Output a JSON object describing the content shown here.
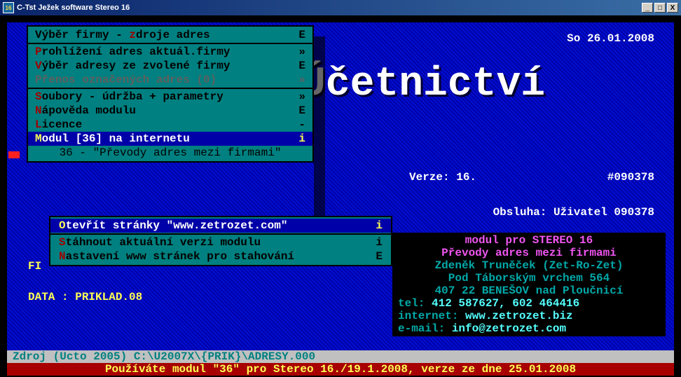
{
  "window": {
    "title": "C-Tst Ježek software Stereo 16",
    "icon_text": "16"
  },
  "date": "So 26.01.2008",
  "big_title": "Účetnictví",
  "version_label": "Verze: 16.",
  "version_id": "#090378",
  "operator_label": "Obsluha: Uživatel 090378",
  "info": {
    "l1": "modul pro STEREO 16",
    "l2": "Převody adres mezi firmami",
    "l3": "Zdeněk Truněček (Zet-Ro-Zet)",
    "l4": "Pod Táborským vrchem 564",
    "l5": "407 22 BENEŠOV nad Ploučnicí",
    "tel_label": "tel:",
    "tel_value": " 412 587627, 602 464416",
    "web_label": "internet:",
    "web_value": " www.zetrozet.biz",
    "mail_label": "e-mail: ",
    "mail_value": " info@zetrozet.com"
  },
  "menu1": {
    "items": [
      {
        "label": "Výběr firmy - ",
        "hk": "z",
        "rest": "droje adres",
        "key": "E",
        "type": "row"
      },
      {
        "type": "sep"
      },
      {
        "hk": "P",
        "rest": "rohlížení adres aktuál.firmy",
        "key": "»",
        "type": "row"
      },
      {
        "hk": "V",
        "rest": "ýběr adresy ze zvolené firmy",
        "key": "E",
        "type": "row"
      },
      {
        "hk": "P",
        "rest": "řenos označených adres (0)",
        "key": "»",
        "type": "row",
        "dim": true
      },
      {
        "type": "sep"
      },
      {
        "hk": "S",
        "rest": "oubory - údržba + parametry",
        "key": "»",
        "type": "row"
      },
      {
        "hk": "N",
        "rest": "ápověda modulu",
        "key": "E",
        "type": "row"
      },
      {
        "hk": "L",
        "rest": "icence",
        "key": "-",
        "type": "row"
      },
      {
        "hk": "M",
        "rest": "odul [36] na internetu",
        "key": "i",
        "type": "row",
        "sel": true
      }
    ],
    "hint": "36 - \"Převody adres mezi firmami\""
  },
  "menu2": {
    "items": [
      {
        "hk": "O",
        "rest": "tevřít stránky \"www.zetrozet.com\"",
        "key": "i",
        "sel": true
      },
      {
        "type": "sep"
      },
      {
        "hk": "S",
        "rest": "táhnout aktuální verzi modulu",
        "key": "i"
      },
      {
        "hk": "N",
        "rest": "astavení www stránek pro stahování",
        "key": "E"
      }
    ]
  },
  "fi_label": "FI",
  "data_label": "DATA : PRIKLAD.08",
  "footer1": " Zdroj (Ucto 2005) C:\\U2007X\\{PRIK}\\ADRESY.000",
  "footer2": "Používáte modul \"36\" pro Stereo 16./19.1.2008, verze ze dne 25.01.2008"
}
